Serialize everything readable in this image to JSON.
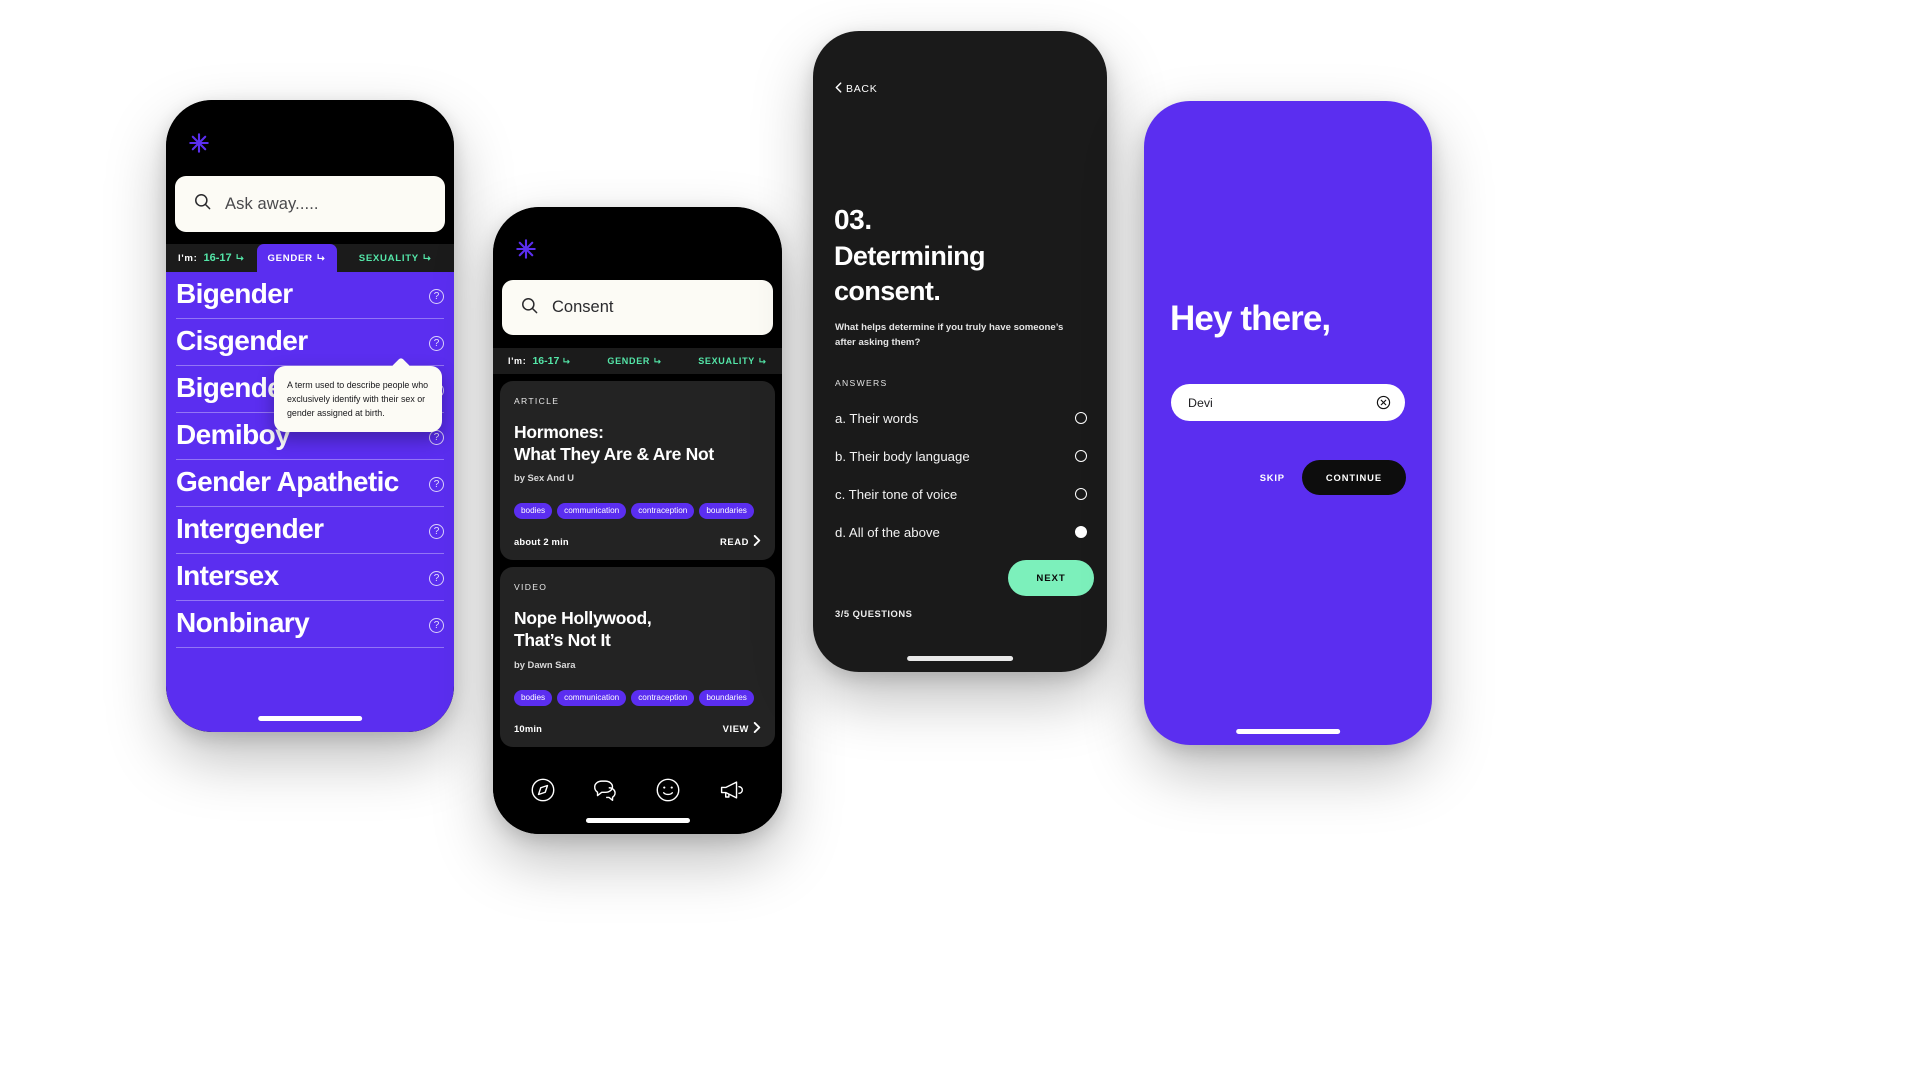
{
  "brand": {
    "accent_purple": "#5B2EF0",
    "accent_mint": "#7CF0BB",
    "cream": "#FCFBF5",
    "black": "#000000",
    "card_gray": "#232323"
  },
  "screen_glossary": {
    "logo_icon": "asterisk-icon",
    "search": {
      "icon": "search-icon",
      "placeholder": "Ask away.....",
      "value": ""
    },
    "filters": {
      "age_prefix": "I'm:",
      "age_value": "16-17",
      "tabs": [
        {
          "label": "GENDER",
          "active": true
        },
        {
          "label": "SEXUALITY",
          "active": false
        }
      ]
    },
    "terms": [
      {
        "name": "Bigender",
        "help_icon": "help-circle-icon"
      },
      {
        "name": "Cisgender",
        "help_icon": "help-circle-icon"
      },
      {
        "name": "Bigender",
        "help_icon": "help-circle-icon"
      },
      {
        "name": "Demiboy",
        "help_icon": "help-circle-icon"
      },
      {
        "name": "Gender Apathetic",
        "help_icon": "help-circle-icon"
      },
      {
        "name": "Intergender",
        "help_icon": "help-circle-icon"
      },
      {
        "name": "Intersex",
        "help_icon": "help-circle-icon"
      },
      {
        "name": "Nonbinary",
        "help_icon": "help-circle-icon"
      }
    ],
    "tooltip": {
      "text": "A term used to describe people who exclusively identify with their sex or gender assigned at birth."
    }
  },
  "screen_feed": {
    "logo_icon": "asterisk-icon",
    "search": {
      "icon": "search-icon",
      "value": "Consent",
      "placeholder": "Ask away....."
    },
    "filters": {
      "age_prefix": "I'm:",
      "age_value": "16-17",
      "tabs": [
        {
          "label": "GENDER"
        },
        {
          "label": "SEXUALITY"
        }
      ]
    },
    "cards": [
      {
        "kicker": "ARTICLE",
        "title_line1": "Hormones:",
        "title_line2": "What They Are & Are Not",
        "byline": "by Sex And U",
        "tags": [
          "bodies",
          "communication",
          "contraception",
          "boundaries"
        ],
        "duration": "about 2 min",
        "cta": "READ"
      },
      {
        "kicker": "VIDEO",
        "title_line1": "Nope Hollywood,",
        "title_line2": "That’s Not It",
        "byline": "by Dawn Sara",
        "tags": [
          "bodies",
          "communication",
          "contraception",
          "boundaries"
        ],
        "duration": "10min",
        "cta": "VIEW"
      }
    ],
    "nav": [
      {
        "icon": "compass-icon",
        "label": "explore"
      },
      {
        "icon": "chat-bubbles-icon",
        "label": "chat"
      },
      {
        "icon": "smiley-face-icon",
        "label": "mood"
      },
      {
        "icon": "megaphone-icon",
        "label": "news"
      }
    ]
  },
  "screen_quiz": {
    "back": {
      "label": "BACK",
      "icon": "chevron-left-icon"
    },
    "number": "03.",
    "title": "Determining consent.",
    "subtitle": "What helps determine if you truly have someone’s after asking them?",
    "answers_label": "ANSWERS",
    "answers": [
      {
        "text": "a. Their words",
        "selected": false
      },
      {
        "text": "b. Their body language",
        "selected": false
      },
      {
        "text": "c. Their tone of voice",
        "selected": false
      },
      {
        "text": "d. All of the above",
        "selected": true
      }
    ],
    "counter": "3/5 QUESTIONS",
    "next_label": "NEXT"
  },
  "screen_welcome": {
    "greeting": "Hey there,",
    "name_field": {
      "value": "Devi",
      "clear_icon": "clear-circle-icon"
    },
    "skip_label": "SKIP",
    "continue_label": "CONTINUE"
  }
}
